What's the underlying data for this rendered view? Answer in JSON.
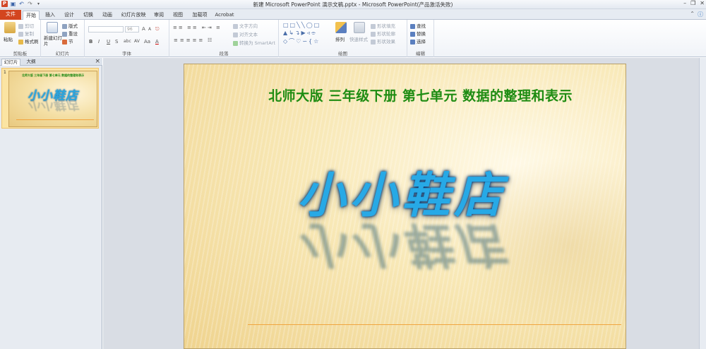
{
  "window": {
    "title": "新建 Microsoft PowerPoint 演示文稿.pptx  -  Microsoft PowerPoint(产品激活失败)"
  },
  "qat": {
    "app_icon": "P",
    "save_icon": "save-icon",
    "undo_icon": "undo-icon",
    "redo_icon": "redo-icon"
  },
  "tabs": [
    {
      "label": "文件"
    },
    {
      "label": "开始"
    },
    {
      "label": "插入"
    },
    {
      "label": "设计"
    },
    {
      "label": "切换"
    },
    {
      "label": "动画"
    },
    {
      "label": "幻灯片放映"
    },
    {
      "label": "审阅"
    },
    {
      "label": "视图"
    },
    {
      "label": "加载项"
    },
    {
      "label": "Acrobat"
    }
  ],
  "ribbon": {
    "clipboard": {
      "label": "剪贴板",
      "paste": "粘贴",
      "cut": "剪切",
      "copy": "复制",
      "format_painter": "格式刷"
    },
    "slides": {
      "label": "幻灯片",
      "new_slide": "新建幻灯片",
      "layout": "版式",
      "reset": "重设",
      "section": "节"
    },
    "font": {
      "label": "字体",
      "size": "96",
      "bold": "B",
      "italic": "I",
      "underline": "U",
      "strike": "S",
      "shadow": "abc",
      "spacing": "AV",
      "case": "Aa",
      "grow": "A",
      "shrink": "A",
      "color": "A"
    },
    "paragraph": {
      "label": "段落",
      "text_direction": "文字方向",
      "align_text": "对齐文本",
      "smartart": "转换为 SmartArt"
    },
    "drawing": {
      "label": "绘图",
      "arrange": "排列",
      "quick_styles": "快速样式",
      "shape_fill": "形状填充",
      "shape_outline": "形状轮廓",
      "shape_effects": "形状效果"
    },
    "editing": {
      "label": "编辑",
      "find": "查找",
      "replace": "替换",
      "select": "选择"
    }
  },
  "left_pane": {
    "tab_slides": "幻灯片",
    "tab_outline": "大纲",
    "close": "×",
    "slide_number": "1"
  },
  "slide": {
    "title": "北师大版  三年级下册  第七单元  数据的整理和表示",
    "main_text": "小小鞋店",
    "thumb_title": "北师大版 三年级下册 第七单元 数据的整理和表示"
  },
  "colors": {
    "file_tab": "#d3451f",
    "title_green": "#1e8c12",
    "main_blue": "#27a9e6"
  }
}
